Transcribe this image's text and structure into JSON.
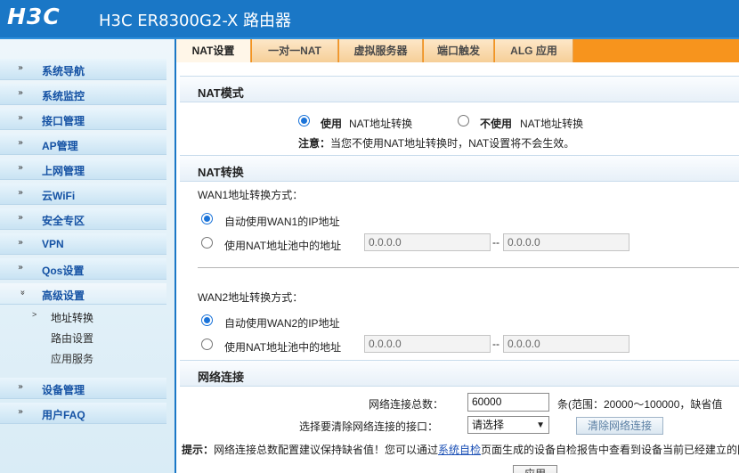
{
  "header": {
    "logo": "H3C",
    "title": "H3C ER8300G2-X 路由器"
  },
  "sidebar": {
    "items": [
      {
        "label": "系统导航"
      },
      {
        "label": "系统监控"
      },
      {
        "label": "接口管理"
      },
      {
        "label": "AP管理"
      },
      {
        "label": "上网管理"
      },
      {
        "label": "云WiFi"
      },
      {
        "label": "安全专区"
      },
      {
        "label": "VPN"
      },
      {
        "label": "Qos设置"
      },
      {
        "label": "高级设置"
      },
      {
        "label": "设备管理"
      },
      {
        "label": "用户FAQ"
      }
    ],
    "subitems": [
      {
        "label": "地址转换"
      },
      {
        "label": "路由设置"
      },
      {
        "label": "应用服务"
      }
    ]
  },
  "tabs": [
    {
      "label": "NAT设置"
    },
    {
      "label": "一对一NAT"
    },
    {
      "label": "虚拟服务器"
    },
    {
      "label": "端口触发"
    },
    {
      "label": "ALG 应用"
    }
  ],
  "nat_mode": {
    "title": "NAT模式",
    "option_on_bold": "使用",
    "option_on_text": "NAT地址转换",
    "option_off_bold": "不使用",
    "option_off_text": "NAT地址转换",
    "note_label": "注意：",
    "note_text": "当您不使用NAT地址转换时，NAT设置将不会生效。"
  },
  "nat_convert": {
    "title": "NAT转换",
    "wan1_label": "WAN1地址转换方式：",
    "wan1_auto": "自动使用WAN1的IP地址",
    "wan1_pool": "使用NAT地址池中的地址",
    "wan1_pool_start": "0.0.0.0",
    "wan1_pool_end": "0.0.0.0",
    "wan2_label": "WAN2地址转换方式：",
    "wan2_auto": "自动使用WAN2的IP地址",
    "wan2_pool": "使用NAT地址池中的地址",
    "wan2_pool_start": "0.0.0.0",
    "wan2_pool_end": "0.0.0.0",
    "dash": "--"
  },
  "net_conn": {
    "title": "网络连接",
    "total_label": "网络连接总数：",
    "total_value": "60000",
    "range_text": "条(范围：20000～100000，缺省值",
    "clear_label": "选择要清除网络连接的接口：",
    "select_value": "请选择",
    "clear_button": "清除网络连接",
    "tip_label": "提示：",
    "tip_text_1": "网络连接总数配置建议保持缺省值！您可以通过",
    "tip_link": "系统自检",
    "tip_text_2": "页面生成的设备自检报告中查看到设备当前已经建立的网",
    "apply_button": "应用"
  },
  "colors": {
    "header_bg": "#1a77c6",
    "tab_accent": "#f7941d",
    "link": "#1a4fb5",
    "radio": "#1a73d9"
  }
}
